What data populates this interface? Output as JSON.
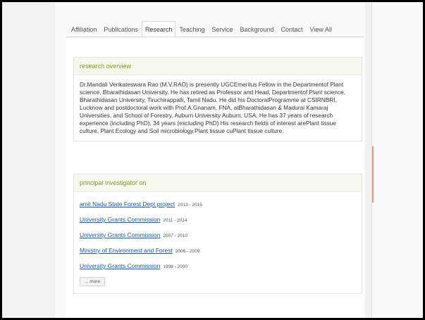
{
  "tabs": [
    {
      "label": "Affiliation"
    },
    {
      "label": "Publications"
    },
    {
      "label": "Research"
    },
    {
      "label": "Teaching"
    },
    {
      "label": "Service"
    },
    {
      "label": "Background"
    },
    {
      "label": "Contact"
    },
    {
      "label": "View All"
    }
  ],
  "active_tab": "Research",
  "overview": {
    "title": "research overview",
    "text": "Dr.Mandali Venkateswara Rao (M.V.RAO) is presently UGCEmeritus Fellow in the Departmentof Plant science, Bharathidasan University. He has retired as Professor and Head, Departmentof Plant science, Bharathidasan University, Tiruchirappalli, Tamil Nadu. He did his DoctoralProgramme at CSIRNBRI, Lucknow and postdoctoral work with Prof.A.Gnanam, FNA, atBharathidasan & Madurai Kamaraj Universities, and School of Forestry, Auburn University Auburn, USA. He has 37 years of research experience (including PhD), 34 years (excluding PhD) His research fields of interest arePlant tissue culture, Plant Ecology and Soil microbiology.Plant tissue cuPlant tissue culture."
  },
  "investigator": {
    "title": "principal investigator on",
    "items": [
      {
        "name": "amil Nadu State Forest Dept project",
        "years": "2013 - 2015"
      },
      {
        "name": "University Grants Commission",
        "years": "2011 - 2014"
      },
      {
        "name": "University Grants Commission",
        "years": "2007 - 2010"
      },
      {
        "name": "Ministry of Environment and Forest",
        "years": "2006 - 2009"
      },
      {
        "name": "University Grants Commission",
        "years": "1998 - 2000"
      }
    ],
    "more_label": "... more"
  }
}
